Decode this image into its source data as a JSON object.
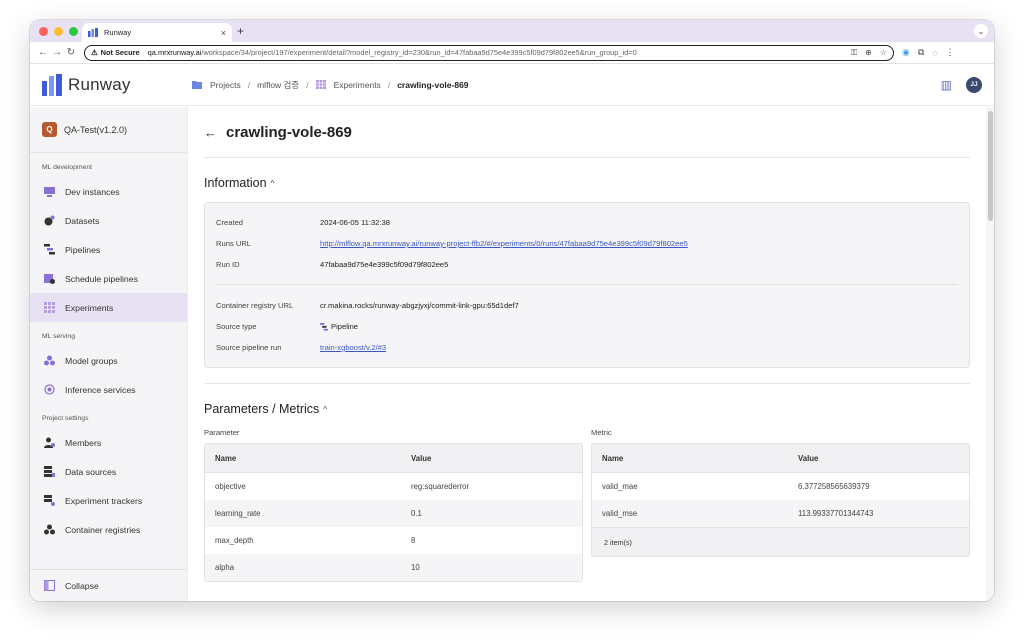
{
  "browser": {
    "tab_title": "Runway",
    "new_tab": "+",
    "not_secure": "Not Secure",
    "url_host": "qa.mrxrunway.ai",
    "url_path": "/workspace/34/project/197/experiment/detail?model_registry_id=230&run_id=47fabaa9d75e4e399c5f09d79f802ee5&run_group_id=0"
  },
  "app": {
    "logo_text": "Runway",
    "breadcrumb": {
      "projects": "Projects",
      "project": "mlflow 검증",
      "experiments": "Experiments",
      "current": "crawling-vole-869"
    },
    "user_initials": "JJ"
  },
  "sidebar": {
    "project_initial": "Q",
    "project_name": "QA-Test(v1.2.0)",
    "section_ml_dev": "ML development",
    "dev_instances": "Dev instances",
    "datasets": "Datasets",
    "pipelines": "Pipelines",
    "schedule_pipelines": "Schedule pipelines",
    "experiments": "Experiments",
    "section_ml_serving": "ML serving",
    "model_groups": "Model groups",
    "inference_services": "Inference services",
    "section_project_settings": "Project settings",
    "members": "Members",
    "data_sources": "Data sources",
    "experiment_trackers": "Experiment trackers",
    "container_registries": "Container registries",
    "collapse": "Collapse"
  },
  "page": {
    "title": "crawling-vole-869",
    "information_title": "Information",
    "info": {
      "created_label": "Created",
      "created": "2024-06-05 11:32:38",
      "runs_url_label": "Runs URL",
      "runs_url": "http://mlflow.qa.mrxrunway.ai/runway-project-ffb2/#/experiments/0/runs/47fabaa9d75e4e399c5f09d79f802ee5",
      "run_id_label": "Run ID",
      "run_id": "47fabaa9d75e4e399c5f09d79f802ee5",
      "container_label": "Container registry URL",
      "container": "cr.makina.rocks/runway-abgzjyxj/commit-link-gpu:65d1def7",
      "source_type_label": "Source type",
      "source_type": "Pipeline",
      "source_run_label": "Source pipeline run",
      "source_run": "train-xgboost/v.2/#3"
    },
    "params_title": "Parameters / Metrics",
    "parameter_caption": "Parameter",
    "metric_caption": "Metric",
    "param_headers": [
      "Name",
      "Value"
    ],
    "params": [
      {
        "name": "objective",
        "value": "reg:squarederror"
      },
      {
        "name": "learning_rate",
        "value": "0.1"
      },
      {
        "name": "max_depth",
        "value": "8"
      },
      {
        "name": "alpha",
        "value": "10"
      }
    ],
    "metric_headers": [
      "Name",
      "Value"
    ],
    "metrics": [
      {
        "name": "valid_mae",
        "value": "6.377258565639379"
      },
      {
        "name": "valid_mse",
        "value": "113.99337701344743"
      }
    ],
    "metric_count": "2 item(s)"
  },
  "colors": {
    "accent": "#e8e0f3",
    "link": "#3a57c4",
    "project_badge": "#b65a2d"
  }
}
